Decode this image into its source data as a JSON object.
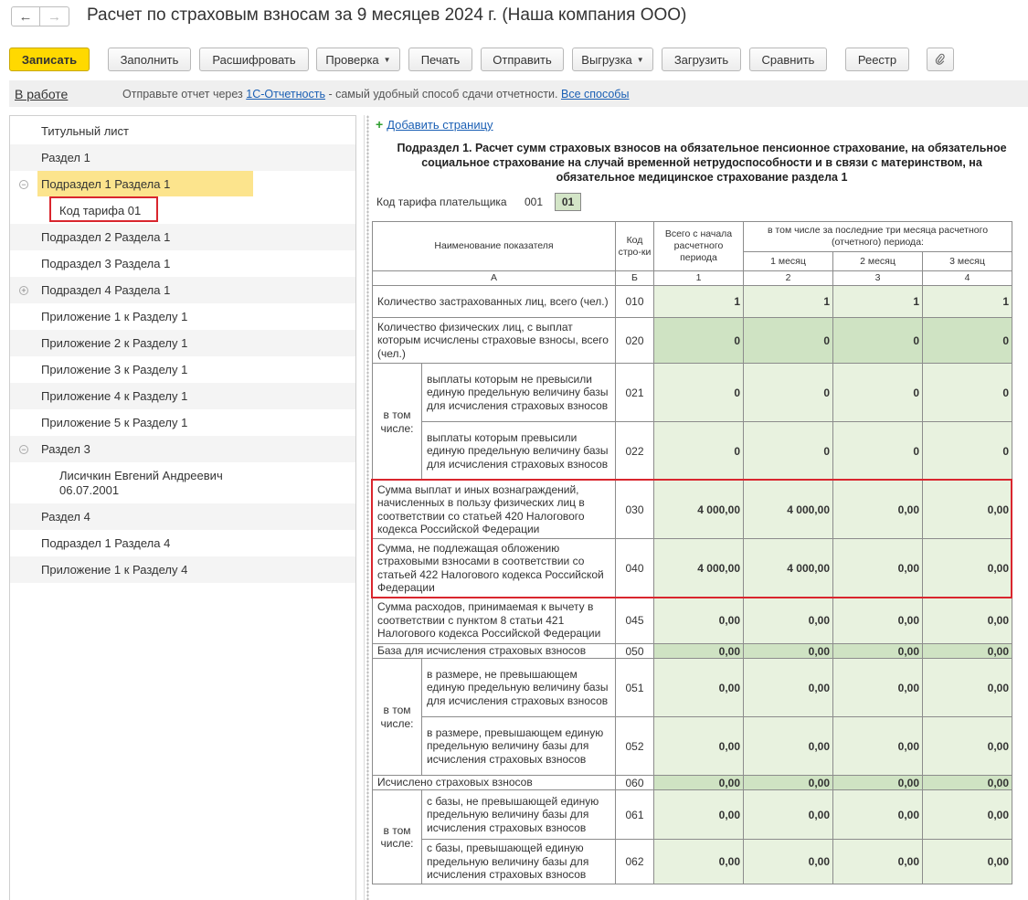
{
  "window": {
    "title": "Расчет по страховым взносам за 9 месяцев 2024 г. (Наша компания ООО)",
    "back_icon": "←",
    "forward_icon": "→"
  },
  "toolbar": {
    "write": "Записать",
    "fill": "Заполнить",
    "decode": "Расшифровать",
    "check": "Проверка",
    "print": "Печать",
    "send": "Отправить",
    "export": "Выгрузка",
    "import": "Загрузить",
    "compare": "Сравнить",
    "registry": "Реестр",
    "caret": "▼"
  },
  "infobar": {
    "status": "В работе",
    "text_before": "Отправьте отчет через ",
    "link1": "1С-Отчетность",
    "text_middle": " - самый удобный способ сдачи отчетности. ",
    "link2": "Все способы"
  },
  "sidebar": {
    "items": [
      {
        "label": "Титульный лист",
        "toggle": ""
      },
      {
        "label": "Раздел 1",
        "toggle": ""
      },
      {
        "label": "Подраздел 1 Раздела 1",
        "toggle": "−"
      },
      {
        "label": "Код тарифа 01",
        "toggle": ""
      },
      {
        "label": "Подраздел 2 Раздела 1",
        "toggle": ""
      },
      {
        "label": "Подраздел 3 Раздела 1",
        "toggle": ""
      },
      {
        "label": "Подраздел 4 Раздела 1",
        "toggle": "+"
      },
      {
        "label": "Приложение 1 к Разделу 1",
        "toggle": ""
      },
      {
        "label": "Приложение 2 к Разделу 1",
        "toggle": ""
      },
      {
        "label": "Приложение 3 к Разделу 1",
        "toggle": ""
      },
      {
        "label": "Приложение 4 к Разделу 1",
        "toggle": ""
      },
      {
        "label": "Приложение 5 к Разделу 1",
        "toggle": ""
      },
      {
        "label": "Раздел 3",
        "toggle": "−"
      },
      {
        "label": "Раздел 4",
        "toggle": ""
      },
      {
        "label": "Подраздел 1 Раздела 4",
        "toggle": ""
      },
      {
        "label": "Приложение 1 к Разделу 4",
        "toggle": ""
      }
    ],
    "person_name": "Лисичкин Евгений Андреевич",
    "person_date": "06.07.2001"
  },
  "main": {
    "add_page": "Добавить страницу",
    "add_plus": "+",
    "title": "Подраздел 1. Расчет сумм страховых взносов на обязательное пенсионное страхование, на обязательное социальное страхование на случай временной нетрудоспособности и в связи с материнством, на обязательное медицинское страхование раздела 1",
    "tariff_label": "Код тарифа плательщика",
    "tariff_code": "001",
    "tariff_value": "01"
  },
  "table": {
    "headers": {
      "name": "Наименование показателя",
      "code": "Код стро-ки",
      "total": "Всего с начала расчетного периода",
      "last3": "в том числе за последние три месяца расчетного (отчетного) периода:",
      "m1": "1 месяц",
      "m2": "2 месяц",
      "m3": "3 месяц",
      "colA": "А",
      "colB": "Б",
      "col1": "1",
      "col2": "2",
      "col3": "3",
      "col4": "4"
    },
    "group_label": "в том числе:",
    "rows": [
      {
        "name": "Количество застрахованных лиц, всего (чел.)",
        "code": "010",
        "values": [
          "1",
          "1",
          "1",
          "1"
        ]
      },
      {
        "name": "Количество физических лиц, с выплат которым исчислены страховые взносы, всего (чел.)",
        "code": "020",
        "values": [
          "0",
          "0",
          "0",
          "0"
        ]
      },
      {
        "name": "выплаты которым не превысили единую предельную величину базы для исчисления страховых взносов",
        "code": "021",
        "values": [
          "0",
          "0",
          "0",
          "0"
        ]
      },
      {
        "name": "выплаты которым превысили единую предельную величину базы для исчисления страховых взносов",
        "code": "022",
        "values": [
          "0",
          "0",
          "0",
          "0"
        ]
      },
      {
        "name": "Сумма выплат и иных вознаграждений, начисленных в пользу физических лиц в соответствии со статьей 420 Налогового кодекса Российской Федерации",
        "code": "030",
        "values": [
          "4 000,00",
          "4 000,00",
          "0,00",
          "0,00"
        ]
      },
      {
        "name": "Сумма, не подлежащая обложению страховыми взносами в соответствии со статьей 422 Налогового кодекса Российской Федерации",
        "code": "040",
        "values": [
          "4 000,00",
          "4 000,00",
          "0,00",
          "0,00"
        ]
      },
      {
        "name": "Сумма расходов, принимаемая к вычету в соответствии с пунктом 8 статьи 421 Налогового кодекса Российской Федерации",
        "code": "045",
        "values": [
          "0,00",
          "0,00",
          "0,00",
          "0,00"
        ]
      },
      {
        "name": "База для исчисления страховых взносов",
        "code": "050",
        "values": [
          "0,00",
          "0,00",
          "0,00",
          "0,00"
        ]
      },
      {
        "name": "в размере, не превышающем единую предельную величину базы для исчисления страховых взносов",
        "code": "051",
        "values": [
          "0,00",
          "0,00",
          "0,00",
          "0,00"
        ]
      },
      {
        "name": "в размере, превышающем единую предельную величину базы для исчисления страховых взносов",
        "code": "052",
        "values": [
          "0,00",
          "0,00",
          "0,00",
          "0,00"
        ]
      },
      {
        "name": "Исчислено страховых взносов",
        "code": "060",
        "values": [
          "0,00",
          "0,00",
          "0,00",
          "0,00"
        ]
      },
      {
        "name": "с базы, не превышающей единую предельную величину базы для исчисления страховых взносов",
        "code": "061",
        "values": [
          "0,00",
          "0,00",
          "0,00",
          "0,00"
        ]
      },
      {
        "name": "с базы, превышающей единую предельную величину базы для исчисления страховых взносов",
        "code": "062",
        "values": [
          "0,00",
          "0,00",
          "0,00",
          "0,00"
        ]
      }
    ]
  }
}
